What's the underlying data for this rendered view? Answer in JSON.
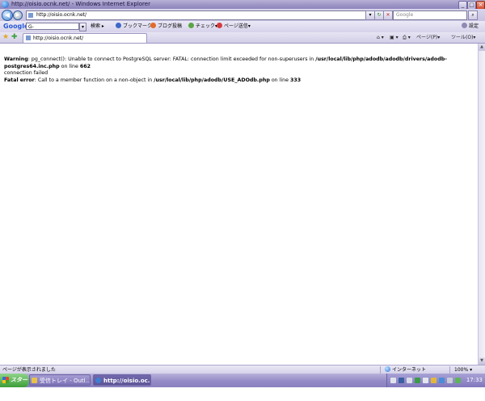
{
  "window": {
    "title": "http://oisio.ocnk.net/ - Windows Internet Explorer"
  },
  "addressbar": {
    "url": "http://oisio.ocnk.net/",
    "search_placeholder": "Google"
  },
  "google_toolbar": {
    "logo": "Google",
    "search_prefix": "G-",
    "items": [
      "検索",
      "ブックマーク",
      "ブログ投稿",
      "チェック",
      "ページ送信"
    ],
    "settings": "設定"
  },
  "tab": {
    "title": "http://oisio.ocnk.net/"
  },
  "commandbar": {
    "page": "ページ(P)",
    "tools": "ツール(O)"
  },
  "content": {
    "line1_label": "Warning",
    "line1_text": ": pg_connect(): Unable to connect to PostgreSQL server: FATAL: connection limit exceeded for non-superusers in ",
    "line1_path": "/usr/local/lib/php/adodb/adodb/drivers/adodb-postgres64.inc.php",
    "line1_online": " on line ",
    "line1_num": "662",
    "line2": "connection failed",
    "line3_label": "Fatal error",
    "line3_text": ": Call to a member function on a non-object in ",
    "line3_path": "/usr/local/lib/php/adodb/USE_ADOdb.php",
    "line3_online": " on line ",
    "line3_num": "333"
  },
  "statusbar": {
    "text": "ページが表示されました",
    "zone": "インターネット",
    "zoom": "100%"
  },
  "taskbar": {
    "start": "スタート",
    "tasks": [
      {
        "label": "受信トレイ - Outl..."
      },
      {
        "label": "http://oisio.oc..."
      }
    ],
    "clock": "17:33"
  },
  "colors": {
    "titlebar": "#9b93c4",
    "taskbar": "#948bc6",
    "start": "#3c9d38"
  }
}
